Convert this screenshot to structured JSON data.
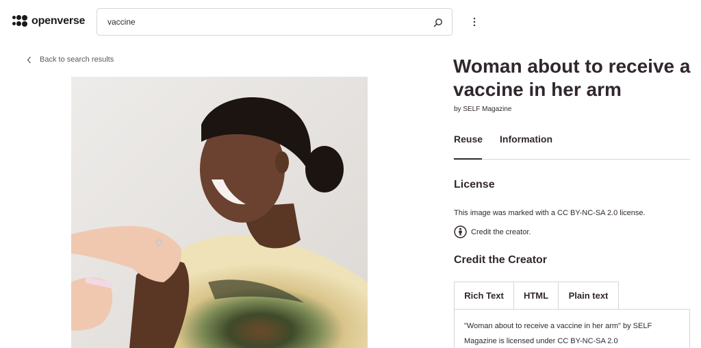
{
  "header": {
    "logo_text": "openverse",
    "search": {
      "value": "vaccine",
      "placeholder": ""
    },
    "search_icon": "search-icon",
    "menu_icon": "vertical-ellipsis-icon"
  },
  "nav": {
    "back_label": "Back to search results"
  },
  "image": {
    "alt": "Woman about to receive a vaccine in her arm"
  },
  "details": {
    "title": "Woman about to receive a vaccine in her arm",
    "byline": "by SELF Magazine",
    "tabs": [
      {
        "label": "Reuse",
        "active": true
      },
      {
        "label": "Information",
        "active": false
      }
    ],
    "license": {
      "heading": "License",
      "text": "This image was marked with a CC BY-NC-SA 2.0 license.",
      "credit_item": "Credit the creator."
    },
    "credit": {
      "heading": "Credit the Creator",
      "formats": [
        "Rich Text",
        "HTML",
        "Plain text"
      ],
      "active_format": "Rich Text",
      "attribution_text": "\"Woman about to receive a vaccine in her arm\" by SELF Magazine is licensed under CC BY-NC-SA 2.0"
    }
  },
  "colors": {
    "text": "#30272e",
    "border": "#d8d4d6",
    "background": "#ffffff"
  }
}
